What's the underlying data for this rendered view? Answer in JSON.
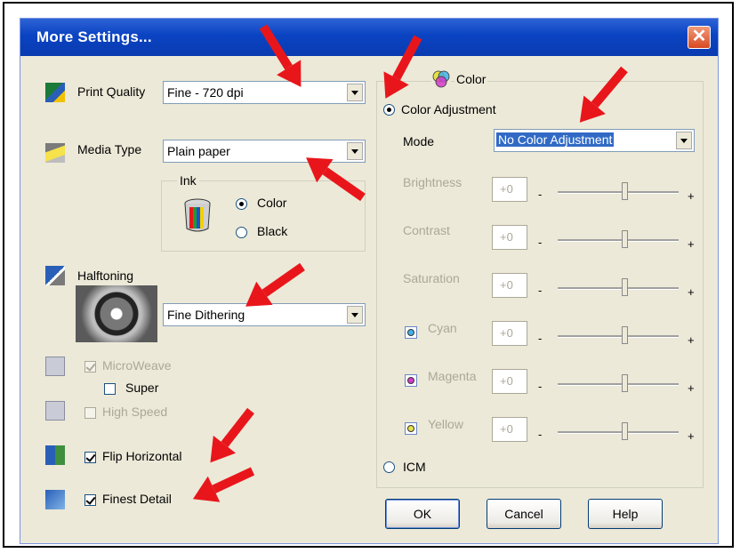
{
  "window": {
    "title": "More Settings...",
    "close_label": "✕"
  },
  "left": {
    "print_quality": {
      "label": "Print Quality",
      "value": "Fine - 720 dpi"
    },
    "media_type": {
      "label": "Media Type",
      "value": "Plain paper"
    },
    "ink": {
      "group_label": "Ink",
      "options": [
        "Color",
        "Black"
      ],
      "selected": "Color"
    },
    "halftoning": {
      "label": "Halftoning",
      "value": "Fine Dithering"
    },
    "checks": {
      "microweave": "MicroWeave",
      "super": "Super",
      "high_speed": "High Speed",
      "flip_horizontal": "Flip Horizontal",
      "finest_detail": "Finest Detail"
    }
  },
  "color": {
    "group_label": "Color",
    "color_adjustment": "Color Adjustment",
    "mode_label": "Mode",
    "mode_value": "No Color Adjustment",
    "sliders": [
      {
        "label": "Brightness",
        "value": "+0",
        "minus": "-",
        "plus": "+"
      },
      {
        "label": "Contrast",
        "value": "+0",
        "minus": "-",
        "plus": "+"
      },
      {
        "label": "Saturation",
        "value": "+0",
        "minus": "-",
        "plus": "+"
      },
      {
        "label": "Cyan",
        "value": "+0",
        "minus": "-",
        "plus": "+"
      },
      {
        "label": "Magenta",
        "value": "+0",
        "minus": "-",
        "plus": "+"
      },
      {
        "label": "Yellow",
        "value": "+0",
        "minus": "-",
        "plus": "+"
      }
    ],
    "icm": "ICM"
  },
  "buttons": {
    "ok": "OK",
    "cancel": "Cancel",
    "help": "Help"
  },
  "colors": {
    "title_bar": "#0a43c2",
    "arrow": "#e8161b",
    "dialog_bg": "#ece9d8",
    "selection": "#316ac5"
  }
}
